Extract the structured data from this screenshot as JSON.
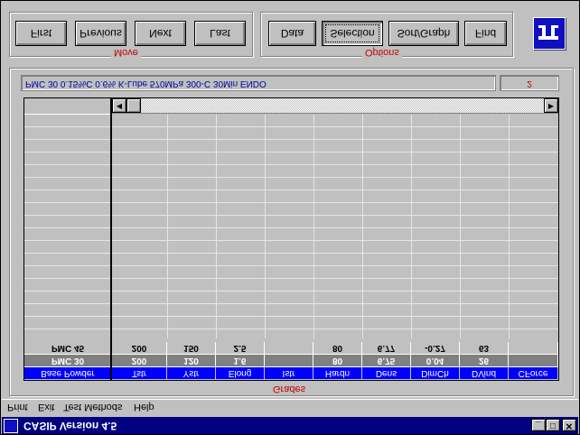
{
  "window": {
    "title": "CASIP Version 4.5",
    "controls": {
      "minimize": "_",
      "maximize": "□",
      "close": "✕"
    }
  },
  "menu": [
    "Print",
    "Exit",
    "Test Methods",
    "Help"
  ],
  "move_group": {
    "label": "Move",
    "buttons": [
      "First",
      "Previous",
      "Next",
      "Last"
    ]
  },
  "options_group": {
    "label": "Options",
    "buttons": [
      "Data",
      "Selection",
      "Sort/Graph",
      "Find"
    ],
    "selected": "Selection"
  },
  "panel": {
    "label": "Grades",
    "description": "PMC 30  0.15%C 0.6% K-Lube 570MPa 300-C 30Min  ENDO",
    "count": "2"
  },
  "grid": {
    "columns": [
      "Base Powder",
      "Tstr",
      "Ystr",
      "Elong",
      "Istr",
      "Hardn",
      "Dens",
      "DimCh",
      "DVind",
      "CForce"
    ],
    "rows": [
      [
        "PMC 45",
        "200",
        "150",
        "2.5",
        "",
        "80",
        "6.77",
        "-0.27",
        "63",
        ""
      ],
      [
        "PMC 30",
        "200",
        "120",
        "1.6",
        "",
        "80",
        "6.75",
        "0.04",
        "26",
        ""
      ]
    ]
  }
}
